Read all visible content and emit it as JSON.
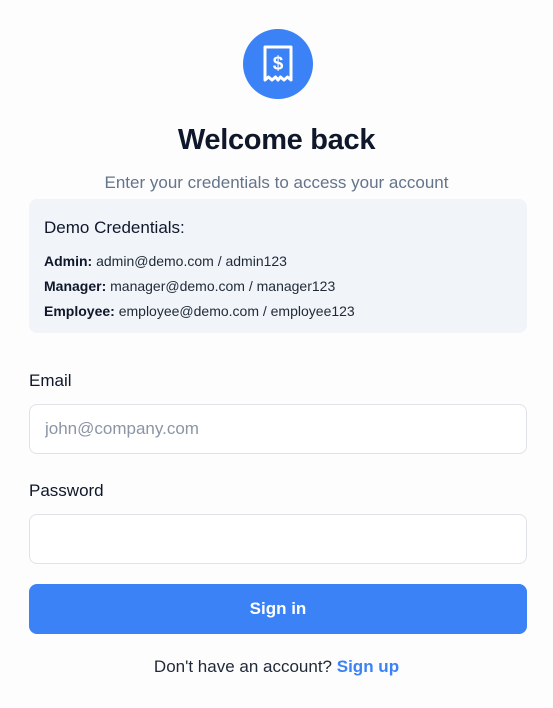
{
  "logo": {
    "icon": "receipt-dollar-icon",
    "color": "#3b82f6"
  },
  "header": {
    "title": "Welcome back",
    "subtitle": "Enter your credentials to access your account"
  },
  "demo": {
    "title": "Demo Credentials:",
    "rows": [
      {
        "role": "Admin:",
        "creds": "admin@demo.com / admin123"
      },
      {
        "role": "Manager:",
        "creds": "manager@demo.com / manager123"
      },
      {
        "role": "Employee:",
        "creds": "employee@demo.com / employee123"
      }
    ]
  },
  "form": {
    "email_label": "Email",
    "email_placeholder": "john@company.com",
    "email_value": "",
    "password_label": "Password",
    "password_value": "",
    "submit_label": "Sign in"
  },
  "footer": {
    "prompt": "Don't have an account?",
    "link": "Sign up"
  },
  "colors": {
    "accent": "#3b82f6",
    "panel": "#f1f5f9"
  }
}
